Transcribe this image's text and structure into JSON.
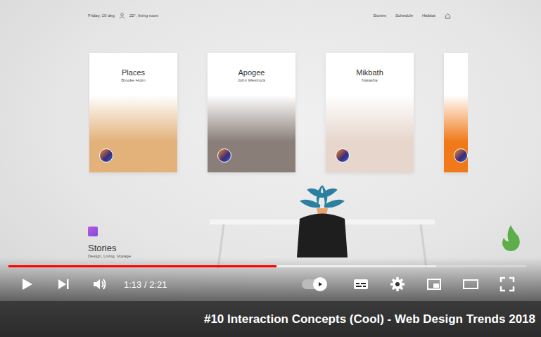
{
  "player": {
    "title": "#10 Interaction Concepts (Cool) - Web Design Trends 2018",
    "time": "1:13 / 2:21",
    "progress": {
      "level": 0.518,
      "buffered": 0.826
    },
    "autoplay": {
      "on": true
    }
  },
  "frame": {
    "top_bar": {
      "date": "Friday, 10 deg",
      "room": "22°, living room",
      "nav": [
        "Stories",
        "Schedule",
        "Habitat"
      ]
    },
    "cards": [
      {
        "title": "Places",
        "subtitle": "Brooke Holm",
        "color": "#e2b27a"
      },
      {
        "title": "Apogee",
        "subtitle": "John Westrock",
        "color": "#8a7f78"
      },
      {
        "title": "Mikbath",
        "subtitle": "Natasha",
        "color": "#e6d6cc"
      },
      {
        "title": "",
        "subtitle": "",
        "color": "#f07a1a"
      }
    ],
    "section": {
      "title": "Stories",
      "tags": "Design, Living, Voyage"
    }
  }
}
